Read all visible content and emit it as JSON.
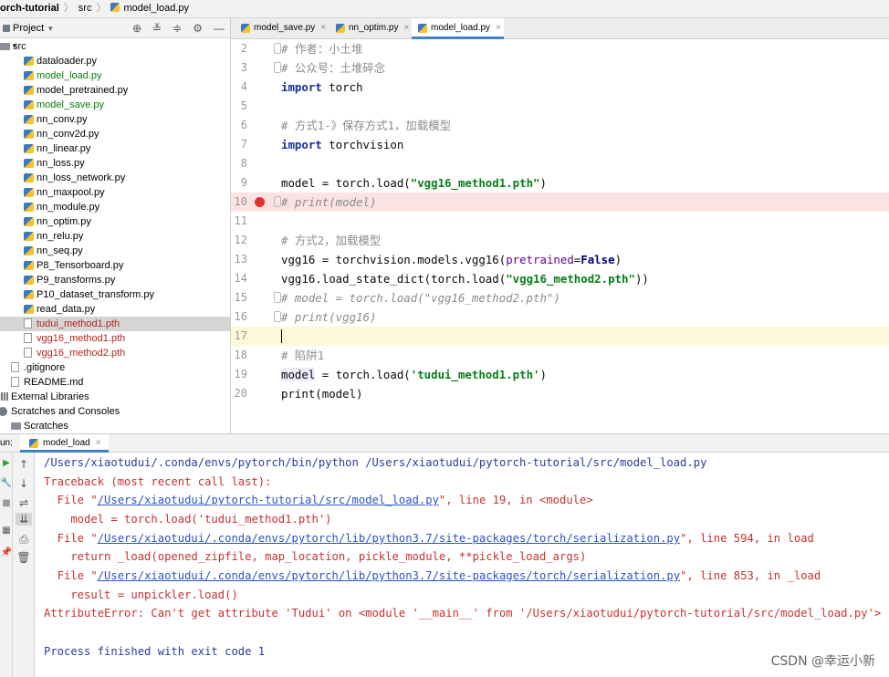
{
  "breadcrumb": {
    "project": "orch-tutorial",
    "folder": "src",
    "file": "model_load.py"
  },
  "project_panel": {
    "title": "Project",
    "items": [
      {
        "label": "src",
        "icon": "folder-icon",
        "color": "#000000"
      },
      {
        "label": "dataloader.py",
        "icon": "python-file-icon",
        "color": "#000000"
      },
      {
        "label": "model_load.py",
        "icon": "python-file-icon",
        "color": "#0a7d0a"
      },
      {
        "label": "model_pretrained.py",
        "icon": "python-file-icon",
        "color": "#000000"
      },
      {
        "label": "model_save.py",
        "icon": "python-file-icon",
        "color": "#0a7d0a"
      },
      {
        "label": "nn_conv.py",
        "icon": "python-file-icon",
        "color": "#000000"
      },
      {
        "label": "nn_conv2d.py",
        "icon": "python-file-icon",
        "color": "#000000"
      },
      {
        "label": "nn_linear.py",
        "icon": "python-file-icon",
        "color": "#000000"
      },
      {
        "label": "nn_loss.py",
        "icon": "python-file-icon",
        "color": "#000000"
      },
      {
        "label": "nn_loss_network.py",
        "icon": "python-file-icon",
        "color": "#000000"
      },
      {
        "label": "nn_maxpool.py",
        "icon": "python-file-icon",
        "color": "#000000"
      },
      {
        "label": "nn_module.py",
        "icon": "python-file-icon",
        "color": "#000000"
      },
      {
        "label": "nn_optim.py",
        "icon": "python-file-icon",
        "color": "#000000"
      },
      {
        "label": "nn_relu.py",
        "icon": "python-file-icon",
        "color": "#000000"
      },
      {
        "label": "nn_seq.py",
        "icon": "python-file-icon",
        "color": "#000000"
      },
      {
        "label": "P8_Tensorboard.py",
        "icon": "python-file-icon",
        "color": "#000000"
      },
      {
        "label": "P9_transforms.py",
        "icon": "python-file-icon",
        "color": "#000000"
      },
      {
        "label": "P10_dataset_transform.py",
        "icon": "python-file-icon",
        "color": "#000000"
      },
      {
        "label": "read_data.py",
        "icon": "python-file-icon",
        "color": "#000000"
      },
      {
        "label": "tudui_method1.pth",
        "icon": "file-icon",
        "color": "#b3261e"
      },
      {
        "label": "vgg16_method1.pth",
        "icon": "file-icon",
        "color": "#b3261e"
      },
      {
        "label": "vgg16_method2.pth",
        "icon": "file-icon",
        "color": "#b3261e"
      },
      {
        "label": ".gitignore",
        "icon": "gitignore-icon",
        "color": "#000000"
      },
      {
        "label": "README.md",
        "icon": "markdown-file-icon",
        "color": "#000000"
      },
      {
        "label": "External Libraries",
        "icon": "library-icon",
        "color": "#000000"
      },
      {
        "label": "Scratches and Consoles",
        "icon": "scratches-icon",
        "color": "#000000"
      },
      {
        "label": "Scratches",
        "icon": "folder-icon",
        "color": "#000000"
      }
    ]
  },
  "editor": {
    "tabs": [
      {
        "label": "model_save.py"
      },
      {
        "label": "nn_optim.py"
      },
      {
        "label": "model_load.py"
      }
    ],
    "lines": [
      {
        "num": "2",
        "code": "# 作者：小土堆"
      },
      {
        "num": "3",
        "code": "# 公众号：土堆碎念"
      },
      {
        "num": "4",
        "kw": "import",
        "rest": " torch"
      },
      {
        "num": "5",
        "code": ""
      },
      {
        "num": "6",
        "code": "# 方式1-》保存方式1，加载模型"
      },
      {
        "num": "7",
        "kw": "import",
        "rest": " torchvision"
      },
      {
        "num": "8",
        "code": ""
      },
      {
        "num": "9",
        "pre": "model = torch.load(",
        "str": "\"vgg16_method1.pth\"",
        "post": ")"
      },
      {
        "num": "10",
        "code": "# print(model)"
      },
      {
        "num": "11",
        "code": ""
      },
      {
        "num": "12",
        "code": "# 方式2，加载模型"
      },
      {
        "num": "13",
        "pre": "vgg16 = torchvision.models.vgg16(",
        "kwarg": "pretrained",
        "eq": "=",
        "kwv": "False",
        "post": ")"
      },
      {
        "num": "14",
        "pre": "vgg16.load_state_dict(torch.load(",
        "str": "\"vgg16_method2.pth\"",
        "post": "))"
      },
      {
        "num": "15",
        "code": "# model = torch.load(\"vgg16_method2.pth\")"
      },
      {
        "num": "16",
        "code": "# print(vgg16)"
      },
      {
        "num": "17",
        "code": ""
      },
      {
        "num": "18",
        "code": "# 陷阱1"
      },
      {
        "num": "19",
        "var": "model",
        "pre": " = torch.load(",
        "str": "'tudui_method1.pth'",
        "post": ")"
      },
      {
        "num": "20",
        "code": "print(model)"
      }
    ]
  },
  "run": {
    "label": "un:",
    "tab": "model_load",
    "console": {
      "cmd": "/Users/xiaotudui/.conda/envs/pytorch/bin/python /Users/xiaotudui/pytorch-tutorial/src/model_load.py",
      "traceback": "Traceback (most recent call last):",
      "f1_pre": "  File \"",
      "f1_link": "/Users/xiaotudui/pytorch-tutorial/src/model_load.py",
      "f1_post": "\", line 19, in <module>",
      "f1_code": "    model = torch.load('tudui_method1.pth')",
      "f2_pre": "  File \"",
      "f2_link": "/Users/xiaotudui/.conda/envs/pytorch/lib/python3.7/site-packages/torch/serialization.py",
      "f2_post": "\", line 594, in load",
      "f2_code": "    return _load(opened_zipfile, map_location, pickle_module, **pickle_load_args)",
      "f3_pre": "  File \"",
      "f3_link": "/Users/xiaotudui/.conda/envs/pytorch/lib/python3.7/site-packages/torch/serialization.py",
      "f3_post": "\", line 853, in _load",
      "f3_code": "    result = unpickler.load()",
      "error": "AttributeError: Can't get attribute 'Tudui' on <module '__main__' from '/Users/xiaotudui/pytorch-tutorial/src/model_load.py'>",
      "finished": "Process finished with exit code 1"
    }
  },
  "watermark": "CSDN @幸运小新"
}
